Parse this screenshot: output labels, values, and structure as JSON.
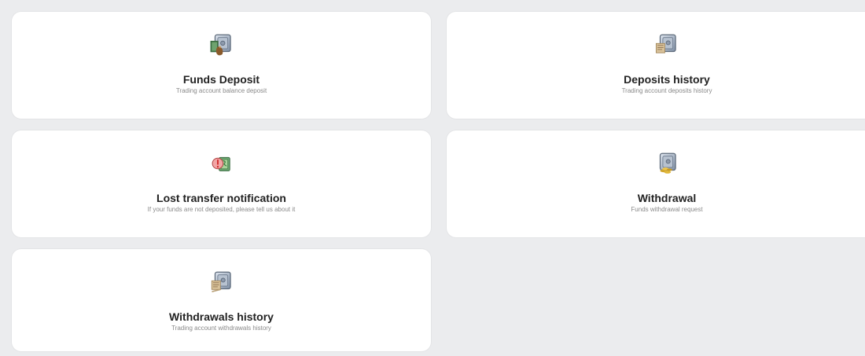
{
  "cards": [
    {
      "title": "Funds Deposit",
      "subtitle": "Trading account balance deposit",
      "icon": "safe-deposit-icon"
    },
    {
      "title": "Deposits history",
      "subtitle": "Trading account deposits history",
      "icon": "safe-history-icon"
    },
    {
      "title": "Lost transfer notification",
      "subtitle": "If your funds are not deposited, please tell us about it",
      "icon": "alert-money-icon"
    },
    {
      "title": "Withdrawal",
      "subtitle": "Funds withdrawal request",
      "icon": "safe-gold-icon"
    },
    {
      "title": "Withdrawals history",
      "subtitle": "Trading account withdrawals history",
      "icon": "safe-receipt-icon"
    }
  ],
  "colors": {
    "background": "#ebecee",
    "card": "#ffffff",
    "title": "#222222",
    "subtitle": "#8a8a8a"
  }
}
